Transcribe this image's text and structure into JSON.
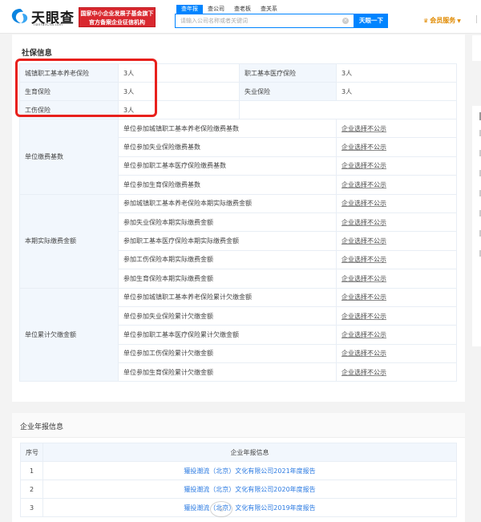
{
  "header": {
    "logo_text": "天眼查",
    "logo_sub": "TianYanCha.com",
    "badge_line1": "国家中小企业发展子基金旗下",
    "badge_line2": "官方备案企业征信机构",
    "tabs": [
      {
        "label": "查年报",
        "active": true
      },
      {
        "label": "查公司",
        "active": false
      },
      {
        "label": "查老板",
        "active": false
      },
      {
        "label": "查关系",
        "active": false
      }
    ],
    "search_placeholder": "请输入公司名称或者关键词",
    "search_button": "天眼一下",
    "vip_label": "会员服务",
    "accent_color": "#0084ff"
  },
  "social_security": {
    "title": "社保信息",
    "basic": [
      {
        "label": "城镇职工基本养老保险",
        "value": "3人",
        "label2": "职工基本医疗保险",
        "value2": "3人"
      },
      {
        "label": "生育保险",
        "value": "3人",
        "label2": "失业保险",
        "value2": "3人"
      },
      {
        "label": "工伤保险",
        "value": "3人",
        "label2": "",
        "value2": ""
      }
    ],
    "groups": [
      {
        "name": "单位缴费基数",
        "rows": [
          {
            "item": "单位参加城镇职工基本养老保险缴费基数",
            "value": "企业选择不公示"
          },
          {
            "item": "单位参加失业保险缴费基数",
            "value": "企业选择不公示"
          },
          {
            "item": "单位参加职工基本医疗保险缴费基数",
            "value": "企业选择不公示"
          },
          {
            "item": "单位参加生育保险缴费基数",
            "value": "企业选择不公示"
          }
        ]
      },
      {
        "name": "本期实际缴费金额",
        "rows": [
          {
            "item": "参加城镇职工基本养老保险本期实际缴费金额",
            "value": "企业选择不公示"
          },
          {
            "item": "参加失业保险本期实际缴费金额",
            "value": "企业选择不公示"
          },
          {
            "item": "参加职工基本医疗保险本期实际缴费金额",
            "value": "企业选择不公示"
          },
          {
            "item": "参加工伤保险本期实际缴费金额",
            "value": "企业选择不公示"
          },
          {
            "item": "参加生育保险本期实际缴费金额",
            "value": "企业选择不公示"
          }
        ]
      },
      {
        "name": "单位累计欠缴金额",
        "rows": [
          {
            "item": "单位参加城镇职工基本养老保险累计欠缴金额",
            "value": "企业选择不公示"
          },
          {
            "item": "单位参加失业保险累计欠缴金额",
            "value": "企业选择不公示"
          },
          {
            "item": "单位参加职工基本医疗保险累计欠缴金额",
            "value": "企业选择不公示"
          },
          {
            "item": "单位参加工伤保险累计欠缴金额",
            "value": "企业选择不公示"
          },
          {
            "item": "单位参加生育保险累计欠缴金额",
            "value": "企业选择不公示"
          }
        ]
      }
    ],
    "highlight_color": "#e8201c"
  },
  "annual_reports": {
    "title": "企业年报信息",
    "col_index": "序号",
    "col_info": "企业年报信息",
    "rows": [
      {
        "index": "1",
        "report": "獾投潮流（北京）文化有限公司2021年度报告"
      },
      {
        "index": "2",
        "report": "獾投潮流（北京）文化有限公司2020年度报告"
      },
      {
        "index": "3",
        "report": "獾投潮流（北京）文化有限公司2019年度报告"
      }
    ],
    "link_color": "#2a7ae2"
  }
}
